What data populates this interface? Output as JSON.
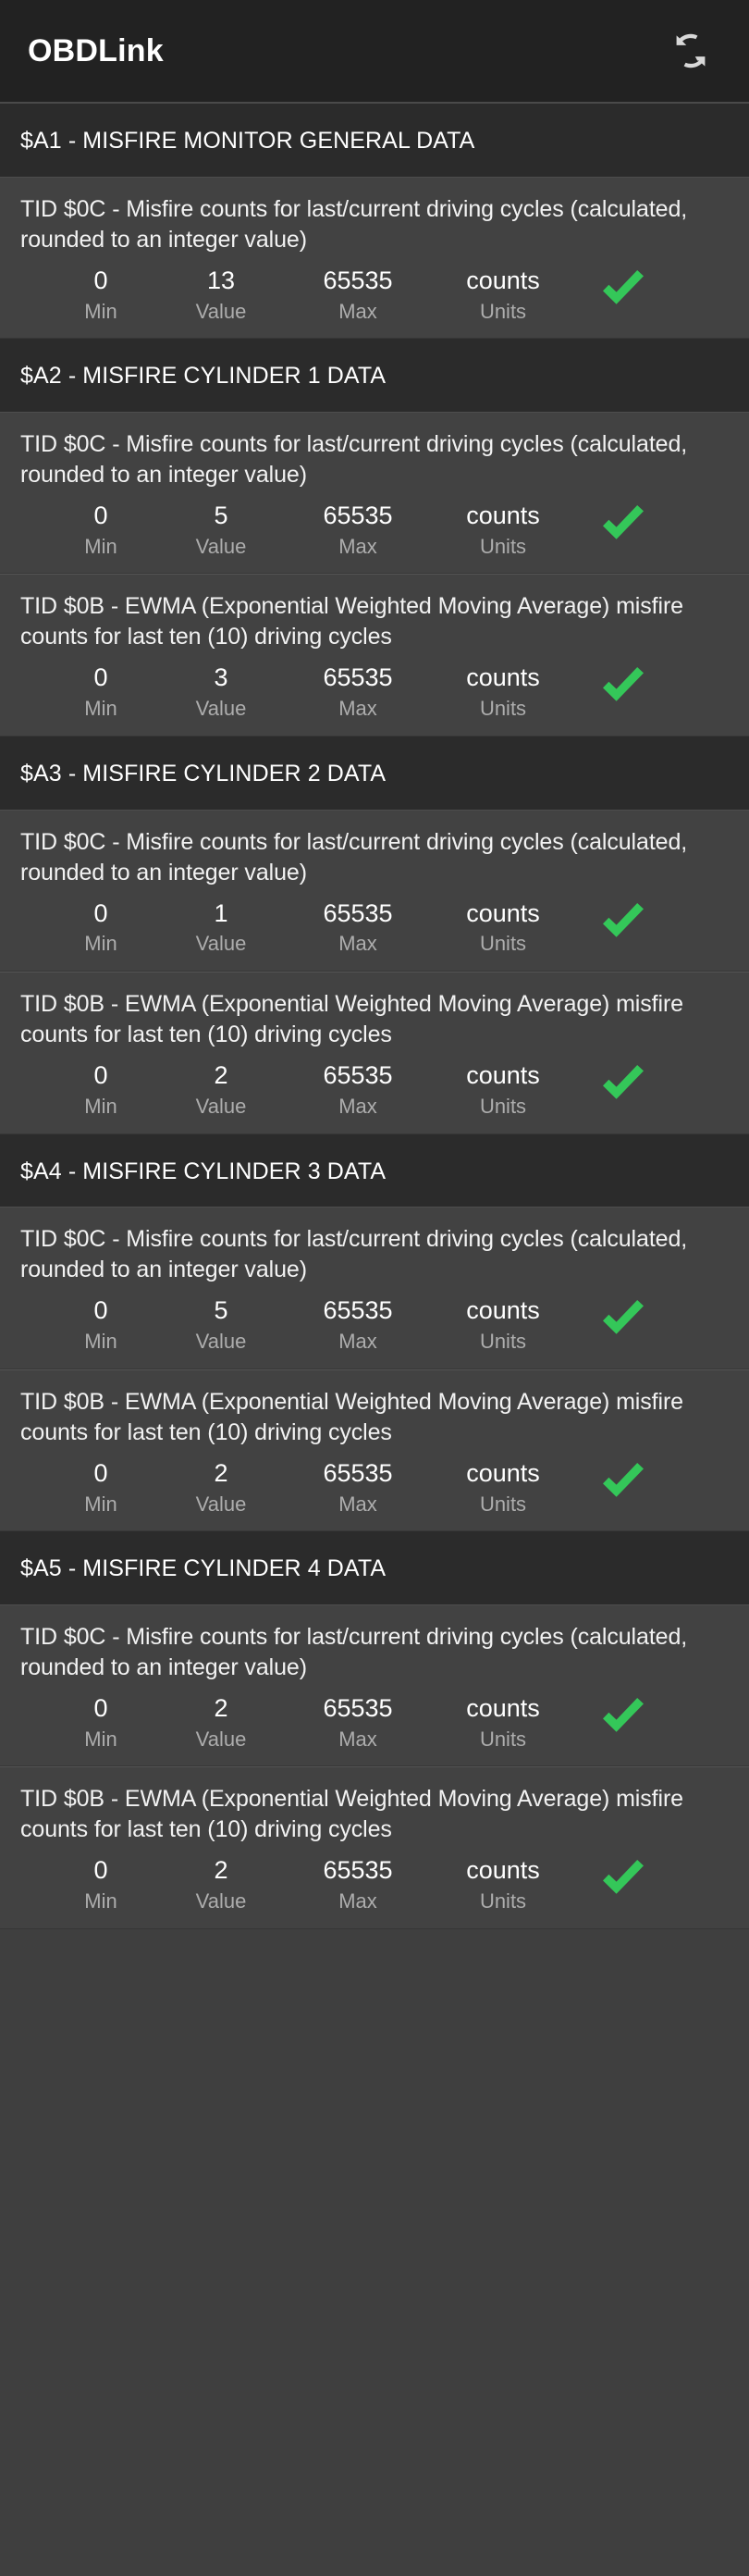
{
  "app": {
    "title": "OBDLink",
    "refresh_icon": "refresh-icon",
    "accent_green": "#34c759",
    "header_bg": "#222222",
    "section_bg": "#2b2b2b",
    "row_bg": "#424242"
  },
  "labels": {
    "min": "Min",
    "value": "Value",
    "max": "Max",
    "units": "Units",
    "status_icon": "check-icon"
  },
  "sections": [
    {
      "title": "$A1 - MISFIRE MONITOR GENERAL DATA",
      "rows": [
        {
          "description": "TID $0C - Misfire counts for last/current driving cycles (calculated, rounded to an integer value)",
          "min": "0",
          "value": "13",
          "max": "65535",
          "units": "counts",
          "status": "ok"
        }
      ]
    },
    {
      "title": "$A2 - MISFIRE CYLINDER 1 DATA",
      "rows": [
        {
          "description": "TID $0C - Misfire counts for last/current driving cycles (calculated, rounded to an integer value)",
          "min": "0",
          "value": "5",
          "max": "65535",
          "units": "counts",
          "status": "ok"
        },
        {
          "description": "TID $0B - EWMA (Exponential Weighted Moving Average) misfire counts for last ten (10) driving cycles",
          "min": "0",
          "value": "3",
          "max": "65535",
          "units": "counts",
          "status": "ok"
        }
      ]
    },
    {
      "title": "$A3 - MISFIRE CYLINDER 2 DATA",
      "rows": [
        {
          "description": "TID $0C - Misfire counts for last/current driving cycles (calculated, rounded to an integer value)",
          "min": "0",
          "value": "1",
          "max": "65535",
          "units": "counts",
          "status": "ok"
        },
        {
          "description": "TID $0B - EWMA (Exponential Weighted Moving Average) misfire counts for last ten (10) driving cycles",
          "min": "0",
          "value": "2",
          "max": "65535",
          "units": "counts",
          "status": "ok"
        }
      ]
    },
    {
      "title": "$A4 - MISFIRE CYLINDER 3 DATA",
      "rows": [
        {
          "description": "TID $0C - Misfire counts for last/current driving cycles (calculated, rounded to an integer value)",
          "min": "0",
          "value": "5",
          "max": "65535",
          "units": "counts",
          "status": "ok"
        },
        {
          "description": "TID $0B - EWMA (Exponential Weighted Moving Average) misfire counts for last ten (10) driving cycles",
          "min": "0",
          "value": "2",
          "max": "65535",
          "units": "counts",
          "status": "ok"
        }
      ]
    },
    {
      "title": "$A5 - MISFIRE CYLINDER 4 DATA",
      "rows": [
        {
          "description": "TID $0C - Misfire counts for last/current driving cycles (calculated, rounded to an integer value)",
          "min": "0",
          "value": "2",
          "max": "65535",
          "units": "counts",
          "status": "ok"
        },
        {
          "description": "TID $0B - EWMA (Exponential Weighted Moving Average) misfire counts for last ten (10) driving cycles",
          "min": "0",
          "value": "2",
          "max": "65535",
          "units": "counts",
          "status": "ok"
        }
      ]
    }
  ]
}
